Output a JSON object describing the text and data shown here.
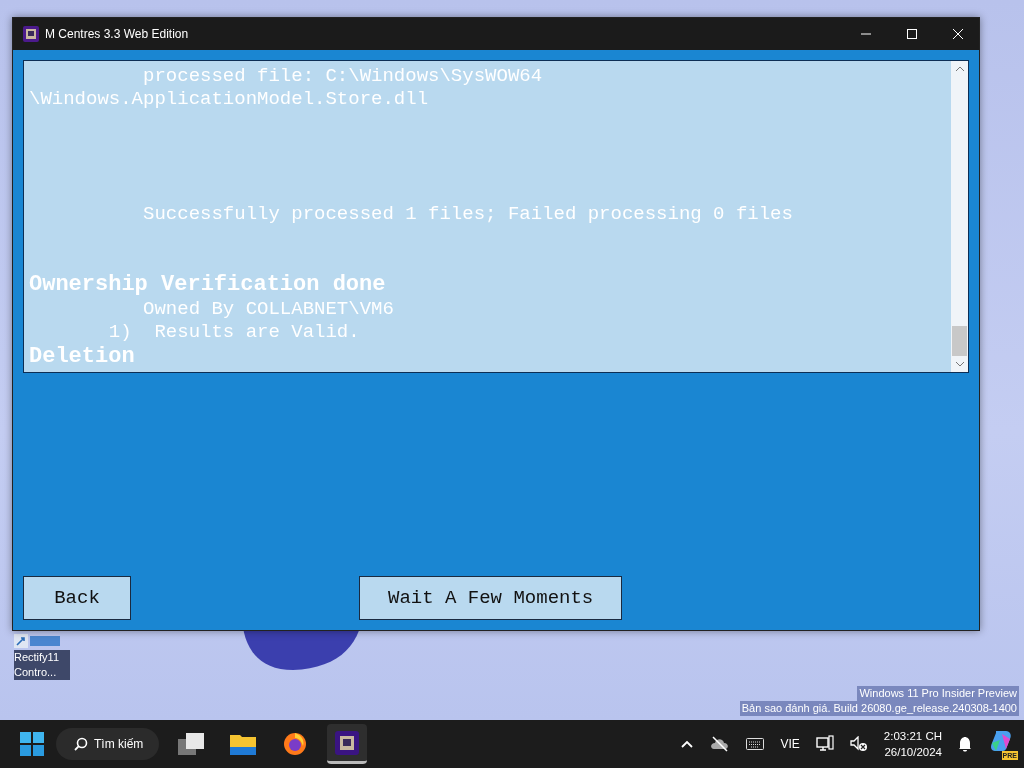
{
  "window": {
    "title": "M Centres 3.3 Web Edition"
  },
  "log": [
    {
      "kind": "line",
      "text": "          processed file: C:\\Windows\\SysWOW64"
    },
    {
      "kind": "line",
      "text": "\\Windows.ApplicationModel.Store.dll"
    },
    {
      "kind": "blank"
    },
    {
      "kind": "blank"
    },
    {
      "kind": "blank"
    },
    {
      "kind": "blank"
    },
    {
      "kind": "line",
      "text": "          Successfully processed 1 files; Failed processing 0 files"
    },
    {
      "kind": "blank"
    },
    {
      "kind": "blank"
    },
    {
      "kind": "heading",
      "text": "Ownership Verification done"
    },
    {
      "kind": "line",
      "text": "          Owned By COLLABNET\\VM6"
    },
    {
      "kind": "line",
      "text": "       1)  Results are Valid."
    },
    {
      "kind": "heading",
      "text": "Deletion"
    }
  ],
  "buttons": [
    {
      "label": "Back"
    },
    {
      "label": "Wait A Few Moments"
    }
  ],
  "desktop": {
    "icons": [
      {
        "label": "Rectify11 Contro..."
      }
    ],
    "watermark": [
      "Windows 11 Pro Insider Preview",
      "Bản sao đánh giá. Build 26080.ge_release.240308-1400"
    ]
  },
  "taskbar": {
    "search": {
      "label": "Tìm kiếm"
    },
    "apps": [
      {
        "kind": "task-view",
        "selected": false
      },
      {
        "kind": "file-explorer",
        "selected": false
      },
      {
        "kind": "firefox",
        "selected": false
      },
      {
        "kind": "app",
        "selected": true
      }
    ],
    "language": "VIE",
    "time": "2:03:21 CH",
    "date": "26/10/2024",
    "copilot_badge": "PRE"
  }
}
